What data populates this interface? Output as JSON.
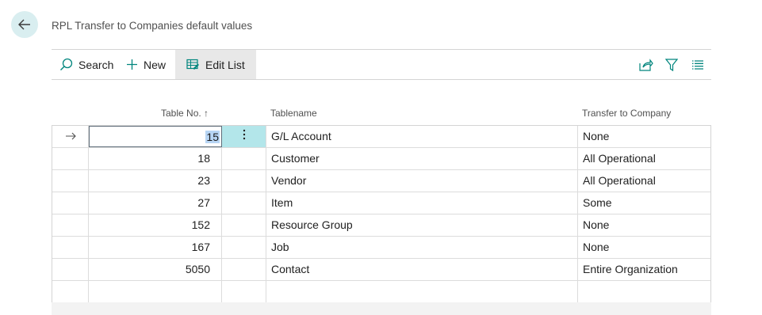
{
  "page": {
    "title": "RPL Transfer to Companies default values"
  },
  "actions": {
    "search": "Search",
    "new": "New",
    "edit_list": "Edit List"
  },
  "columns": {
    "table_no": "Table No.",
    "sort_indicator": "↑",
    "tablename": "Tablename",
    "transfer": "Transfer to Company"
  },
  "rows": [
    {
      "table_no": "15",
      "tablename": "G/L Account",
      "transfer": "None"
    },
    {
      "table_no": "18",
      "tablename": "Customer",
      "transfer": "All Operational"
    },
    {
      "table_no": "23",
      "tablename": "Vendor",
      "transfer": "All Operational"
    },
    {
      "table_no": "27",
      "tablename": "Item",
      "transfer": "Some"
    },
    {
      "table_no": "152",
      "tablename": "Resource Group",
      "transfer": "None"
    },
    {
      "table_no": "167",
      "tablename": "Job",
      "transfer": "None"
    },
    {
      "table_no": "5050",
      "tablename": "Contact",
      "transfer": "Entire Organization"
    }
  ],
  "icons": {
    "back": "back-arrow-icon",
    "search": "search-icon",
    "new": "plus-icon",
    "edit_list": "edit-list-icon",
    "share": "share-icon",
    "filter": "filter-icon",
    "list": "list-view-icon",
    "row_indicator": "row-arrow-icon",
    "row_menu": "more-vertical-icon"
  },
  "colors": {
    "accent": "#00857d",
    "selection": "#b3e6ea",
    "back_bg": "#d9eef0"
  }
}
